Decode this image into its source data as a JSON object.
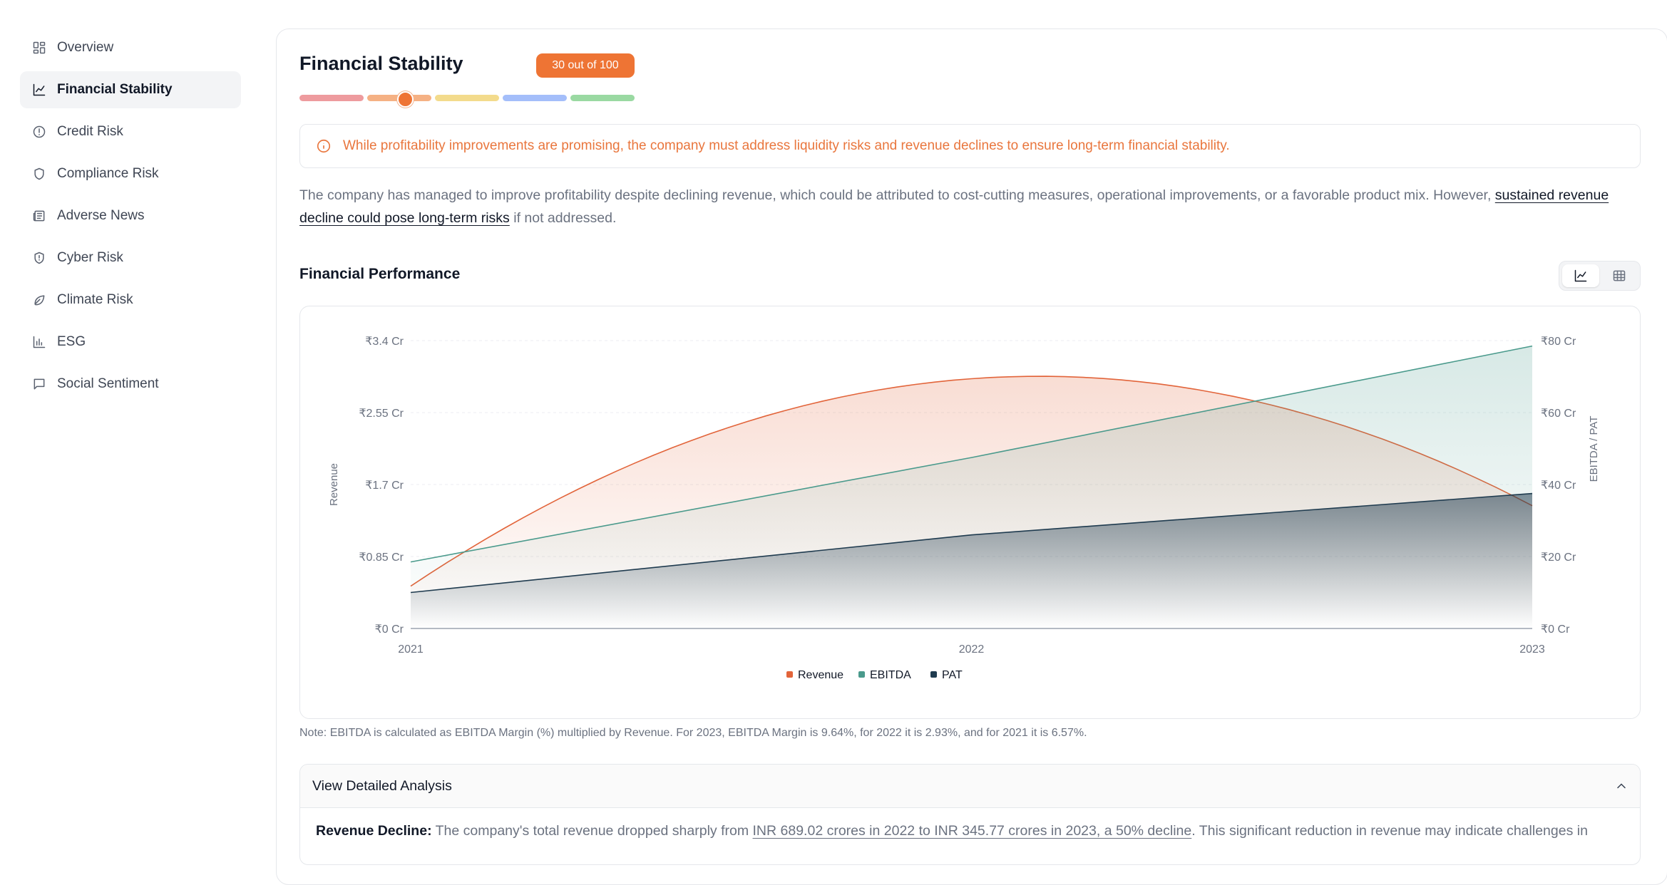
{
  "sidebar": {
    "items": [
      {
        "label": "Overview",
        "icon": "dashboard-grid-icon",
        "active": false
      },
      {
        "label": "Financial Stability",
        "icon": "line-chart-icon",
        "active": true
      },
      {
        "label": "Credit Risk",
        "icon": "alert-circle-icon",
        "active": false
      },
      {
        "label": "Compliance Risk",
        "icon": "shield-icon",
        "active": false
      },
      {
        "label": "Adverse News",
        "icon": "newspaper-icon",
        "active": false
      },
      {
        "label": "Cyber Risk",
        "icon": "shield-alert-icon",
        "active": false
      },
      {
        "label": "Climate Risk",
        "icon": "leaf-icon",
        "active": false
      },
      {
        "label": "ESG",
        "icon": "bar-chart-icon",
        "active": false
      },
      {
        "label": "Social Sentiment",
        "icon": "message-square-icon",
        "active": false
      }
    ]
  },
  "header": {
    "title": "Financial Stability",
    "score_badge": "30 out of 100",
    "score_value": 30,
    "score_max": 100,
    "scale_colors": [
      "#ee9b9e",
      "#f5b184",
      "#f3db8c",
      "#a4befa",
      "#9ad9a2"
    ],
    "accent": "#ee7434"
  },
  "alert": {
    "icon": "info-circle-icon",
    "text": "While profitability improvements are promising, the company must address liquidity risks and revenue declines to ensure long-term financial stability."
  },
  "summary": {
    "before": "The company has managed to improve profitability despite declining revenue, which could be attributed to cost-cutting measures, operational improvements, or a favorable product mix. However, ",
    "highlight": "sustained revenue decline could pose long-term risks",
    "after": " if not addressed."
  },
  "performance": {
    "title": "Financial Performance",
    "view_toggle": {
      "options": [
        "chart-view-icon",
        "table-view-icon"
      ],
      "selected": "chart-view-icon"
    }
  },
  "chart_data": {
    "type": "area",
    "x": [
      "2021",
      "2022",
      "2023"
    ],
    "left_axis": {
      "label": "Revenue",
      "ticks": [
        "₹0 Cr",
        "₹0.85 Cr",
        "₹1.7 Cr",
        "₹2.55 Cr",
        "₹3.4 Cr"
      ],
      "ylim": [
        0,
        3.4
      ]
    },
    "right_axis": {
      "label": "EBITDA / PAT",
      "ticks": [
        "₹0 Cr",
        "₹20 Cr",
        "₹40 Cr",
        "₹60 Cr",
        "₹80 Cr"
      ],
      "ylim": [
        0,
        80
      ]
    },
    "series": [
      {
        "name": "Revenue",
        "axis": "left",
        "color": "#e2643a",
        "values": [
          0.5,
          2.95,
          1.45
        ]
      },
      {
        "name": "EBITDA",
        "axis": "right",
        "color": "#4a9a8c",
        "values": [
          18.5,
          47.5,
          78.5
        ]
      },
      {
        "name": "PAT",
        "axis": "right",
        "color": "#1f3b4f",
        "values": [
          10,
          26,
          37.5
        ]
      }
    ],
    "grid": true,
    "legend": "bottom"
  },
  "note": "Note: EBITDA is calculated as EBITDA Margin (%) multiplied by Revenue. For 2023, EBITDA Margin is 9.64%, for 2022 it is 2.93%, and for 2021 it is 6.57%.",
  "analysis": {
    "title": "View Detailed Analysis",
    "lead": "Revenue Decline:",
    "text_before": " The company's total revenue dropped sharply from ",
    "highlight": "INR 689.02 crores in 2022 to INR 345.77 crores in 2023, a 50% decline",
    "text_after": ". This significant reduction in revenue may indicate challenges in"
  }
}
